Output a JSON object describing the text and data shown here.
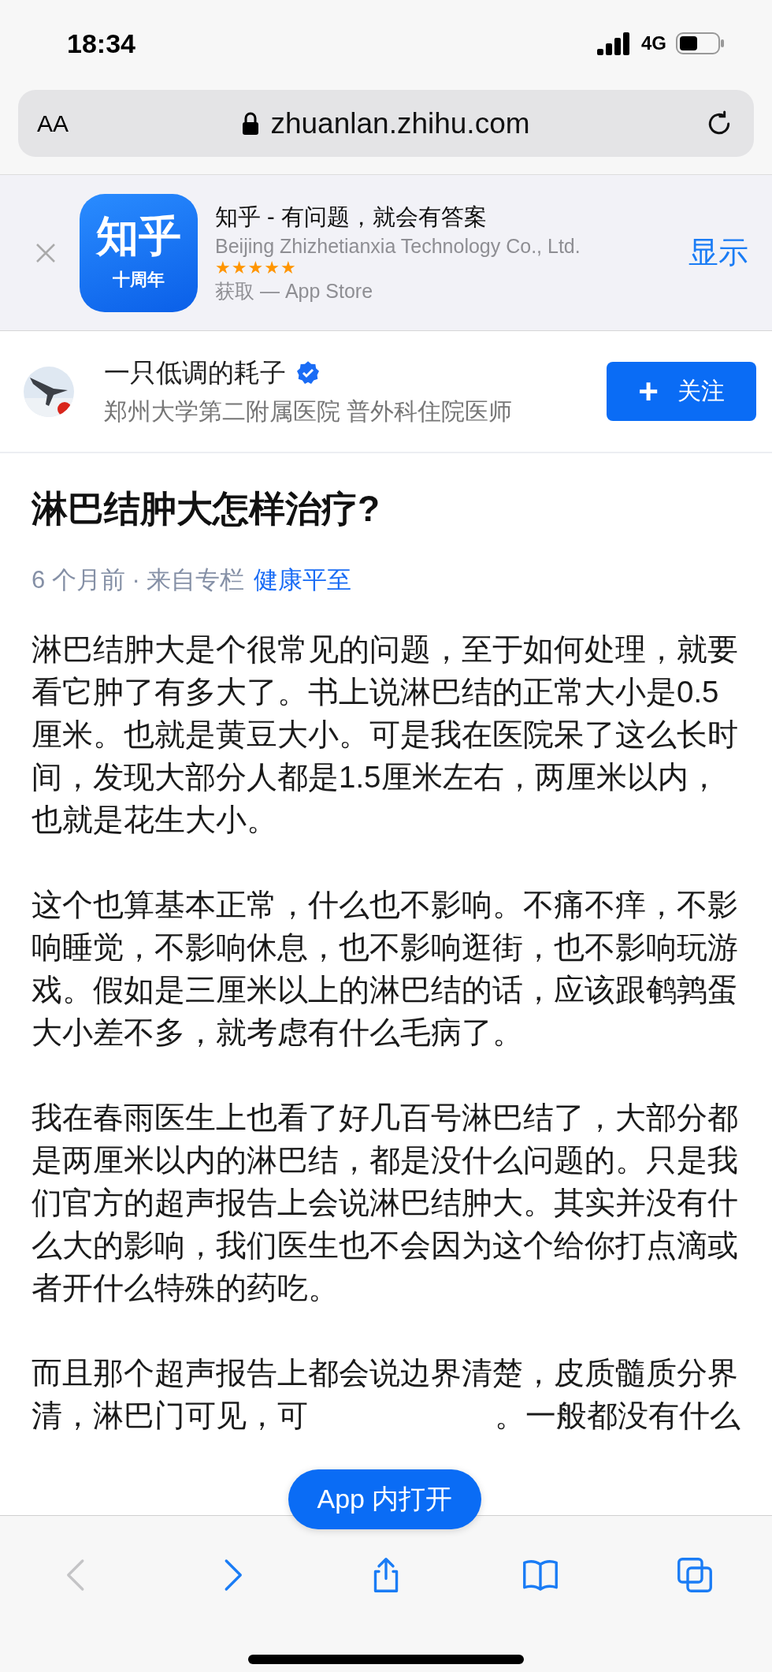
{
  "status_bar": {
    "time": "18:34",
    "network": "4G"
  },
  "address_bar": {
    "text_size": "AA",
    "url": "zhuanlan.zhihu.com"
  },
  "app_banner": {
    "app_name": "知乎 - 有问题，就会有答案",
    "developer": "Beijing Zhizhetianxia Technology Co., Ltd.",
    "stars": 5,
    "store": "获取 — App Store",
    "action": "显示",
    "icon_text": "知乎",
    "icon_subtext": "十周年"
  },
  "author": {
    "name": "一只低调的耗子",
    "verified": true,
    "bio": "郑州大学第二附属医院 普外科住院医师",
    "follow_icon": "+",
    "follow_label": "关注"
  },
  "article": {
    "title": "淋巴结肿大怎样治疗?",
    "meta": "6 个月前 · 来自专栏",
    "column": "健康平至",
    "paragraphs": [
      "淋巴结肿大是个很常见的问题，至于如何处理，就要看它肿了有多大了。书上说淋巴结的正常大小是0.5厘米。也就是黄豆大小。可是我在医院呆了这么长时间，发现大部分人都是1.5厘米左右，两厘米以内，也就是花生大小。",
      "这个也算基本正常，什么也不影响。不痛不痒，不影响睡觉，不影响休息，也不影响逛街，也不影响玩游戏。假如是三厘米以上的淋巴结的话，应该跟鹌鹑蛋大小差不多，就考虑有什么毛病了。",
      "我在春雨医生上也看了好几百号淋巴结了，大部分都是两厘米以内的淋巴结，都是没什么问题的。只是我们官方的超声报告上会说淋巴结肿大。其实并没有什么大的影响，我们医生也不会因为这个给你打点滴或者开什么特殊的药吃。"
    ],
    "last_paragraph": {
      "line": "而且那个超声报告上都会说边界清楚，皮质髓质分界",
      "cut_before": "清，淋巴门可见，可",
      "cut_after": "。一般都没有什么"
    }
  },
  "open_in_app": "App 内打开",
  "toolbar": [
    {
      "kind": "back",
      "disabled": true
    },
    {
      "kind": "forward",
      "disabled": false
    },
    {
      "kind": "share",
      "disabled": false
    },
    {
      "kind": "bookmarks",
      "disabled": false
    },
    {
      "kind": "tabs",
      "disabled": false
    }
  ]
}
